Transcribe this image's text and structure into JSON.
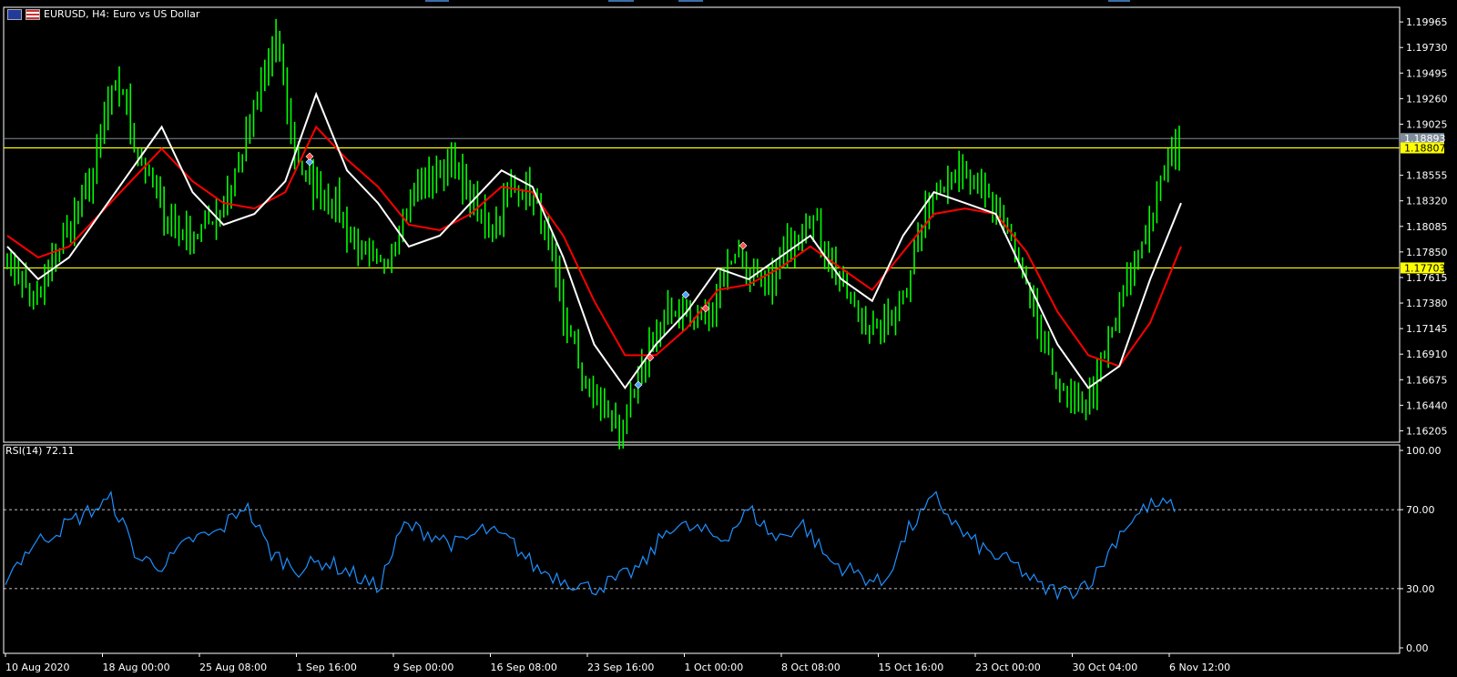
{
  "header": {
    "symbol": "EURUSD, H4:",
    "description": "Euro vs US Dollar"
  },
  "colors": {
    "background": "#000000",
    "candles": "#00ff00",
    "ma_fast": "#ffffff",
    "ma_slow": "#ff0000",
    "hlines": "#ffff00",
    "rsi": "#1e90ff",
    "bid_line": "#7f8c9a"
  },
  "price_axis_labels": [
    "1.19965",
    "1.19730",
    "1.19495",
    "1.19260",
    "1.19025",
    "1.18555",
    "1.18320",
    "1.18085",
    "1.17850",
    "1.17615",
    "1.17380",
    "1.17145",
    "1.16910",
    "1.16675",
    "1.16440",
    "1.16205"
  ],
  "price_tags": {
    "bid": "1.18893",
    "level_upper": "1.18807",
    "level_lower": "1.17703"
  },
  "rsi": {
    "label": "RSI(14) 72.11",
    "axis_labels": [
      "100.00",
      "70.00",
      "30.00",
      "0.00"
    ]
  },
  "time_axis_labels": [
    "10 Aug 2020",
    "18 Aug 00:00",
    "25 Aug 08:00",
    "1 Sep 16:00",
    "9 Sep 00:00",
    "16 Sep 08:00",
    "23 Sep 16:00",
    "1 Oct 00:00",
    "8 Oct 08:00",
    "15 Oct 16:00",
    "23 Oct 00:00",
    "30 Oct 04:00",
    "6 Nov 12:00"
  ],
  "chart_data": {
    "type": "line",
    "title": "EURUSD, H4:  Euro vs US Dollar",
    "ylim": [
      1.161,
      2.0
    ],
    "ylim_price": [
      1.161,
      1.201
    ],
    "categories": [
      "10 Aug 2020",
      "18 Aug 00:00",
      "25 Aug 08:00",
      "1 Sep 16:00",
      "9 Sep 00:00",
      "16 Sep 08:00",
      "23 Sep 16:00",
      "1 Oct 00:00",
      "8 Oct 08:00",
      "15 Oct 16:00",
      "23 Oct 00:00",
      "30 Oct 04:00",
      "6 Nov 12:00"
    ],
    "horizontal_levels": [
      1.18807,
      1.17703
    ],
    "current_price": 1.18893,
    "series": [
      {
        "name": "Price",
        "values": [
          1.178,
          1.176,
          1.174,
          1.177,
          1.18,
          1.183,
          1.186,
          1.192,
          1.194,
          1.188,
          1.185,
          1.182,
          1.1805,
          1.18,
          1.181,
          1.183,
          1.186,
          1.19,
          1.195,
          1.198,
          1.188,
          1.185,
          1.184,
          1.183,
          1.18,
          1.178,
          1.177,
          1.179,
          1.183,
          1.185,
          1.186,
          1.187,
          1.1845,
          1.182,
          1.181,
          1.184,
          1.1845,
          1.183,
          1.178,
          1.172,
          1.168,
          1.165,
          1.164,
          1.162,
          1.166,
          1.17,
          1.172,
          1.174,
          1.172,
          1.173,
          1.176,
          1.179,
          1.176,
          1.175,
          1.177,
          1.18,
          1.182,
          1.18,
          1.176,
          1.174,
          1.172,
          1.171,
          1.173,
          1.176,
          1.181,
          1.185,
          1.186,
          1.185,
          1.184,
          1.183,
          1.18,
          1.176,
          1.172,
          1.168,
          1.165,
          1.164,
          1.166,
          1.17,
          1.174,
          1.178,
          1.182,
          1.186,
          1.189
        ]
      },
      {
        "name": "",
        "values": [
          1.179,
          1.176,
          1.178,
          1.182,
          1.186,
          1.19,
          1.184,
          1.181,
          1.182,
          1.185,
          1.193,
          1.186,
          1.183,
          1.179,
          1.18,
          1.183,
          1.186,
          1.1845,
          1.178,
          1.17,
          1.166,
          1.17,
          1.173,
          1.177,
          1.176,
          1.178,
          1.18,
          1.176,
          1.174,
          1.18,
          1.184,
          1.183,
          1.182,
          1.176,
          1.17,
          1.166,
          1.168,
          1.176,
          1.183
        ]
      },
      {
        "name": "",
        "values": [
          1.18,
          1.178,
          1.179,
          1.182,
          1.185,
          1.188,
          1.185,
          1.183,
          1.1825,
          1.184,
          1.19,
          1.187,
          1.1845,
          1.181,
          1.1805,
          1.182,
          1.1845,
          1.184,
          1.18,
          1.174,
          1.169,
          1.169,
          1.1715,
          1.175,
          1.1755,
          1.177,
          1.179,
          1.177,
          1.175,
          1.1785,
          1.182,
          1.1825,
          1.182,
          1.1785,
          1.173,
          1.169,
          1.168,
          1.172,
          1.179
        ]
      },
      {
        "name": "RSI(14)",
        "values": [
          36,
          52,
          60,
          68,
          75,
          45,
          42,
          55,
          58,
          73,
          48,
          40,
          44,
          38,
          30,
          62,
          58,
          52,
          60,
          54,
          40,
          35,
          30,
          34,
          42,
          62,
          60,
          55,
          70,
          55,
          63,
          44,
          38,
          32,
          60,
          76,
          58,
          48,
          42,
          30,
          28,
          36,
          60,
          72,
          72
        ]
      }
    ]
  }
}
